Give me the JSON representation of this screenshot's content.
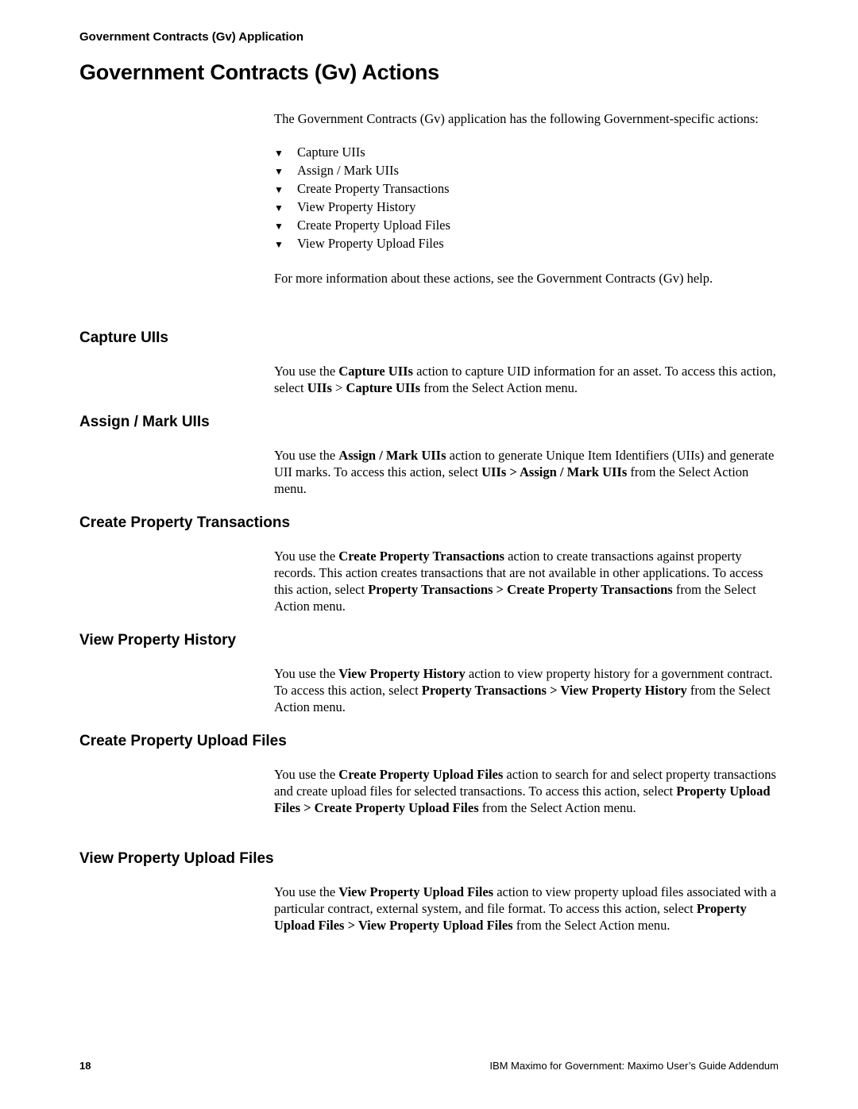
{
  "header": {
    "running_title": "Government Contracts (Gv) Application",
    "page_title": "Government Contracts (Gv) Actions"
  },
  "intro": {
    "lead": "The Government Contracts (Gv) application has the following Government-specific actions:",
    "bullet_icon": "down-triangle-icon",
    "bullet_glyph": "▼",
    "bullets": [
      "Capture UIIs",
      "Assign / Mark UIIs",
      "Create Property Transactions",
      "View Property History",
      "Create Property Upload Files",
      "View Property Upload Files"
    ],
    "more_info": "For more information about these actions, see the Government Contracts (Gv) help."
  },
  "sections": [
    {
      "heading": "Capture UIIs",
      "parts": [
        {
          "t": "You use the "
        },
        {
          "b": "Capture UIIs"
        },
        {
          "t": " action to capture UID information for an asset. To access this action, select "
        },
        {
          "b": "UIIs"
        },
        {
          "t": " > "
        },
        {
          "b": "Capture UIIs"
        },
        {
          "t": " from the Select Action menu."
        }
      ]
    },
    {
      "heading": "Assign / Mark UIIs",
      "parts": [
        {
          "t": "You use the "
        },
        {
          "b": "Assign / Mark UIIs"
        },
        {
          "t": " action to generate Unique Item Identifiers (UIIs) and generate UII marks. To access this action, select "
        },
        {
          "b": "UIIs > Assign / Mark UIIs"
        },
        {
          "t": " from the Select Action menu."
        }
      ]
    },
    {
      "heading": "Create Property Transactions",
      "parts": [
        {
          "t": "You use the "
        },
        {
          "b": "Create Property Transactions"
        },
        {
          "t": " action to create transactions against property records. This action creates transactions that are not available in other applications. To access this action, select "
        },
        {
          "b": "Property Transactions > Create Property Transactions"
        },
        {
          "t": " from the Select Action menu."
        }
      ]
    },
    {
      "heading": "View Property History",
      "parts": [
        {
          "t": "You use the "
        },
        {
          "b": "View Property History"
        },
        {
          "t": " action to view property history for a government contract. To access this action, select "
        },
        {
          "b": "Property Transactions > View Property History"
        },
        {
          "t": " from the Select Action menu."
        }
      ]
    },
    {
      "heading": "Create Property Upload Files",
      "parts": [
        {
          "t": "You use the "
        },
        {
          "b": "Create Property Upload Files"
        },
        {
          "t": " action to search for and select property transactions and create upload files for selected transactions. To access this action, select "
        },
        {
          "b": "Property Upload Files > Create Property Upload Files"
        },
        {
          "t": " from the Select Action menu."
        }
      ]
    },
    {
      "heading": "View Property Upload Files",
      "parts": [
        {
          "t": "You use the "
        },
        {
          "b": "View Property Upload Files"
        },
        {
          "t": " action to view property upload files associated with a particular contract, external system, and file format. To access this action, select "
        },
        {
          "b": "Property Upload Files > View Property Upload Files"
        },
        {
          "t": " from the Select Action menu."
        }
      ]
    }
  ],
  "footer": {
    "page_number": "18",
    "book_title": "IBM Maximo for Government: Maximo User’s Guide Addendum"
  }
}
